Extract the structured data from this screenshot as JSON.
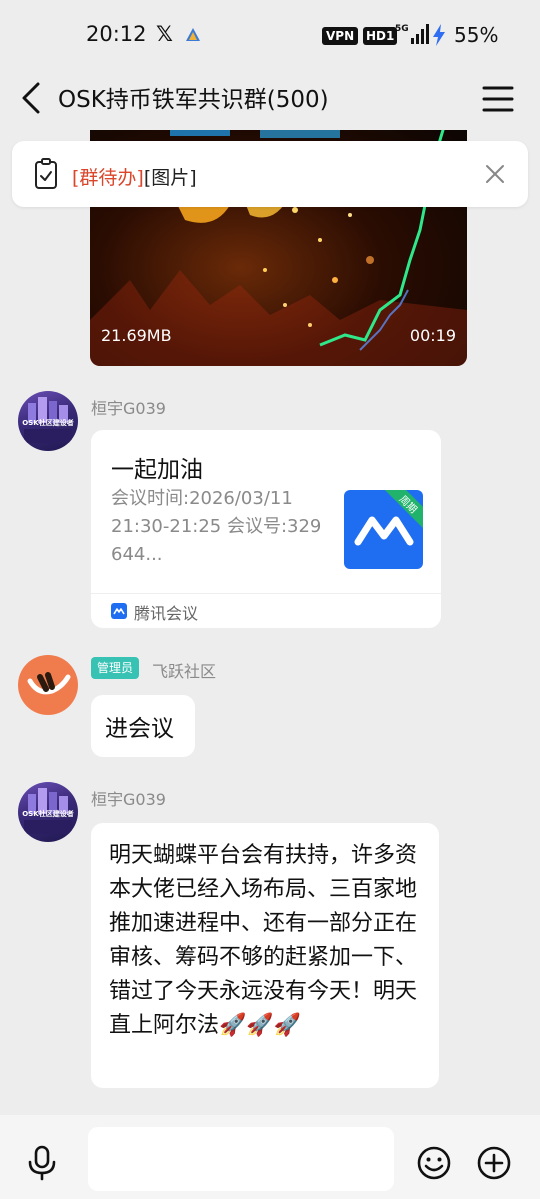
{
  "status": {
    "time": "20:12",
    "x_glyph": "𝕏",
    "vpn": "VPN",
    "hd": "HD1",
    "network": "5G",
    "battery": "55%"
  },
  "header": {
    "title": "OSK持币铁军共识群(500)"
  },
  "notice": {
    "tag": "[群待办]",
    "text": "[图片]"
  },
  "video": {
    "size": "21.69MB",
    "duration": "00:19"
  },
  "messages": [
    {
      "sender": "桓宇G039",
      "avatar_caption": "OSK社区建设者"
    },
    {
      "sender": "桓宇G039",
      "card": {
        "title": "一起加油",
        "desc": "会议时间:2026/03/11 21:30-21:25  会议号:329 644...",
        "logo_tag": "周期",
        "source": "腾讯会议"
      }
    },
    {
      "sender": "飞跃社区",
      "badge": "管理员",
      "text": "进会议"
    },
    {
      "sender": "桓宇G039",
      "avatar_caption": "OSK社区建设者",
      "text": "明天蝴蝶平台会有扶持，许多资本大佬已经入场布局、三百家地推加速进程中、还有一部分正在审核、筹码不够的赶紧加一下、错过了今天永远没有今天！明天直上阿尔法🚀🚀🚀"
    }
  ],
  "input": {
    "placeholder": ""
  },
  "colors": {
    "accent_red": "#d9462b",
    "admin_badge": "#38c2b4",
    "meeting_blue": "#1f6ef2"
  }
}
